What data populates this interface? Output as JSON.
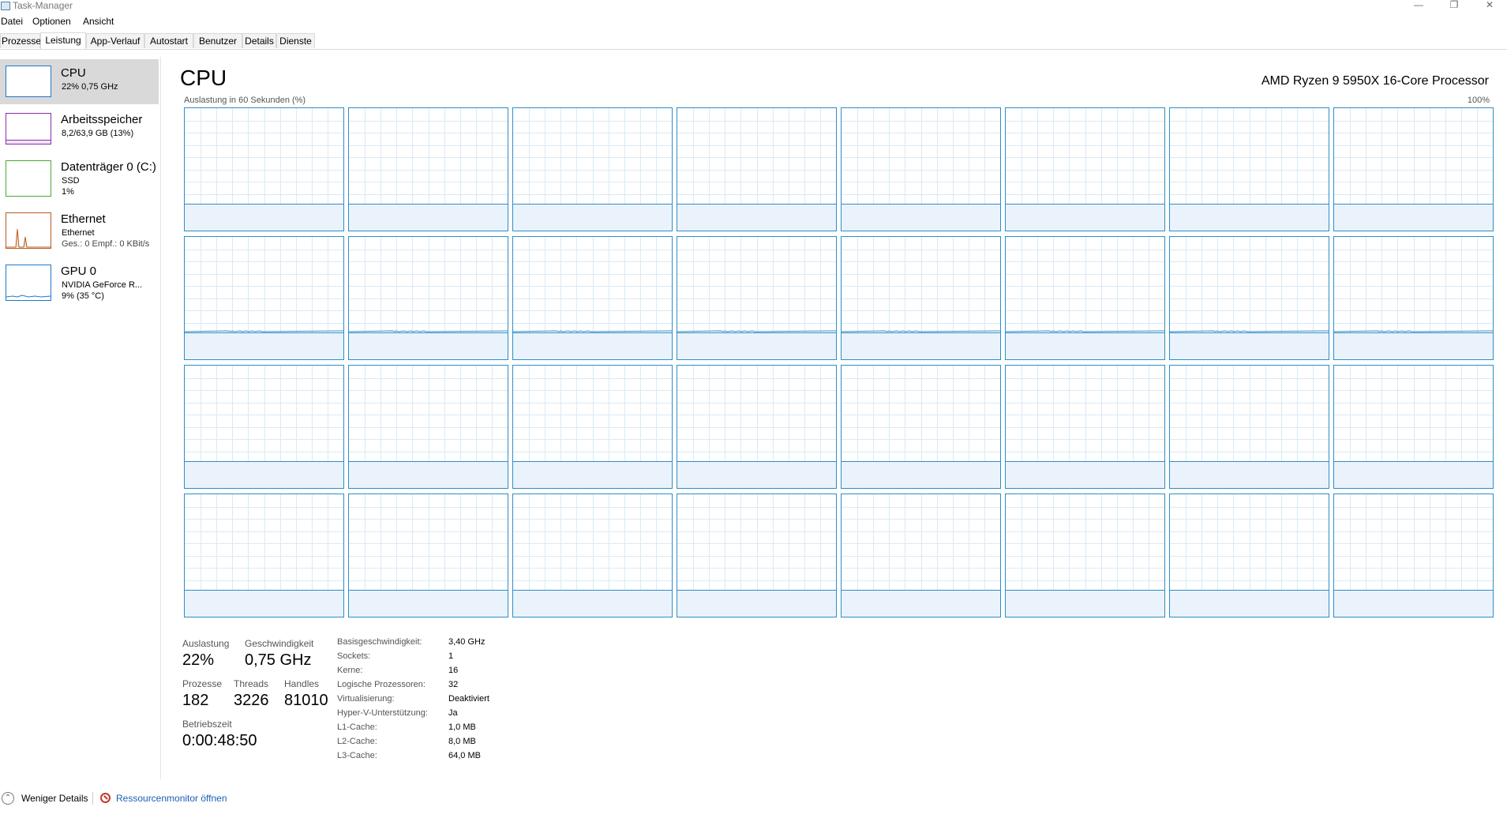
{
  "window": {
    "title": "Task-Manager"
  },
  "menu": [
    "Datei",
    "Optionen",
    "Ansicht"
  ],
  "tabs": [
    "Prozesse",
    "Leistung",
    "App-Verlauf",
    "Autostart",
    "Benutzer",
    "Details",
    "Dienste"
  ],
  "active_tab": "Leistung",
  "sidebar": [
    {
      "title": "CPU",
      "lines": [
        "22% 0,75 GHz"
      ],
      "color": "#1e78c8"
    },
    {
      "title": "Arbeitsspeicher",
      "lines": [
        "8,2/63,9 GB (13%)"
      ],
      "color": "#8b2ca8"
    },
    {
      "title": "Datenträger 0 (C:)",
      "lines": [
        "SSD",
        "1%"
      ],
      "color": "#4aa832"
    },
    {
      "title": "Ethernet",
      "lines": [
        "Ethernet",
        "Ges.: 0 Empf.: 0 KBit/s"
      ],
      "color": "#b85c1e"
    },
    {
      "title": "GPU 0",
      "lines": [
        "NVIDIA GeForce R...",
        "9% (35 °C)"
      ],
      "color": "#1e78c8"
    }
  ],
  "main": {
    "title": "CPU",
    "cpu_name": "AMD Ryzen 9 5950X 16-Core Processor",
    "graph_label": "Auslastung in 60 Sekunden (%)",
    "graph_max": "100%",
    "core_count": 32,
    "graph_color": "#2f8dc7"
  },
  "stats": {
    "auslastung_label": "Auslastung",
    "auslastung": "22%",
    "geschwindigkeit_label": "Geschwindigkeit",
    "geschwindigkeit": "0,75 GHz",
    "prozesse_label": "Prozesse",
    "prozesse": "182",
    "threads_label": "Threads",
    "threads": "3226",
    "handles_label": "Handles",
    "handles": "81010",
    "betriebszeit_label": "Betriebszeit",
    "betriebszeit": "0:00:48:50"
  },
  "specs": [
    {
      "key": "Basisgeschwindigkeit:",
      "value": "3,40 GHz"
    },
    {
      "key": "Sockets:",
      "value": "1"
    },
    {
      "key": "Kerne:",
      "value": "16"
    },
    {
      "key": "Logische Prozessoren:",
      "value": "32"
    },
    {
      "key": "Virtualisierung:",
      "value": "Deaktiviert"
    },
    {
      "key": "Hyper-V-Unterstützung:",
      "value": "Ja"
    },
    {
      "key": "L1-Cache:",
      "value": "1,0 MB"
    },
    {
      "key": "L2-Cache:",
      "value": "8,0 MB"
    },
    {
      "key": "L3-Cache:",
      "value": "64,0 MB"
    }
  ],
  "footer": {
    "less_details": "Weniger Details",
    "resource_monitor": "Ressourcenmonitor öffnen"
  }
}
